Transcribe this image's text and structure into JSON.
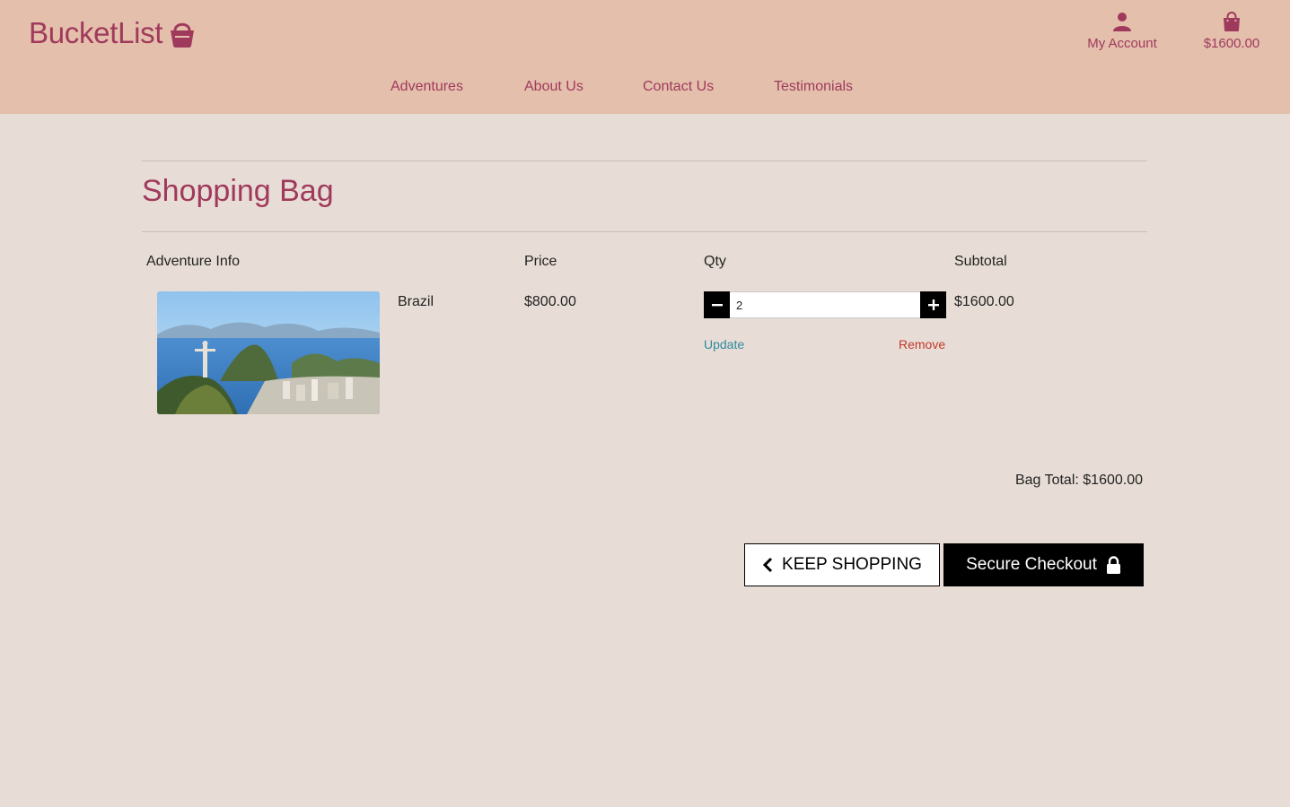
{
  "brand": {
    "name": "BucketList",
    "icon": "basket-icon",
    "color": "#a03a5c"
  },
  "header": {
    "account_label": "My Account",
    "account_icon": "user-icon",
    "bag_total": "$1600.00",
    "bag_icon": "shopping-bag-icon",
    "background": "#e4bfac"
  },
  "nav": {
    "items": [
      {
        "label": "Adventures"
      },
      {
        "label": "About Us"
      },
      {
        "label": "Contact Us"
      },
      {
        "label": "Testimonials"
      }
    ]
  },
  "page": {
    "title": "Shopping Bag",
    "background": "#e8ddd6"
  },
  "table": {
    "headers": {
      "info": "Adventure Info",
      "price": "Price",
      "qty": "Qty",
      "subtotal": "Subtotal"
    },
    "rows": [
      {
        "image_alt": "Brazil",
        "name": "Brazil",
        "price": "$800.00",
        "qty": "2",
        "subtotal": "$1600.00",
        "update_label": "Update",
        "remove_label": "Remove"
      }
    ]
  },
  "summary": {
    "bag_total_text": "Bag Total: $1600.00"
  },
  "actions": {
    "keep_shopping_label": "KEEP SHOPPING",
    "keep_shopping_icon": "chevron-left-icon",
    "checkout_label": "Secure Checkout",
    "checkout_icon": "lock-icon"
  },
  "colors": {
    "accent": "#a03a5c",
    "update_link": "#2f8aa0",
    "remove_link": "#c0392b"
  }
}
